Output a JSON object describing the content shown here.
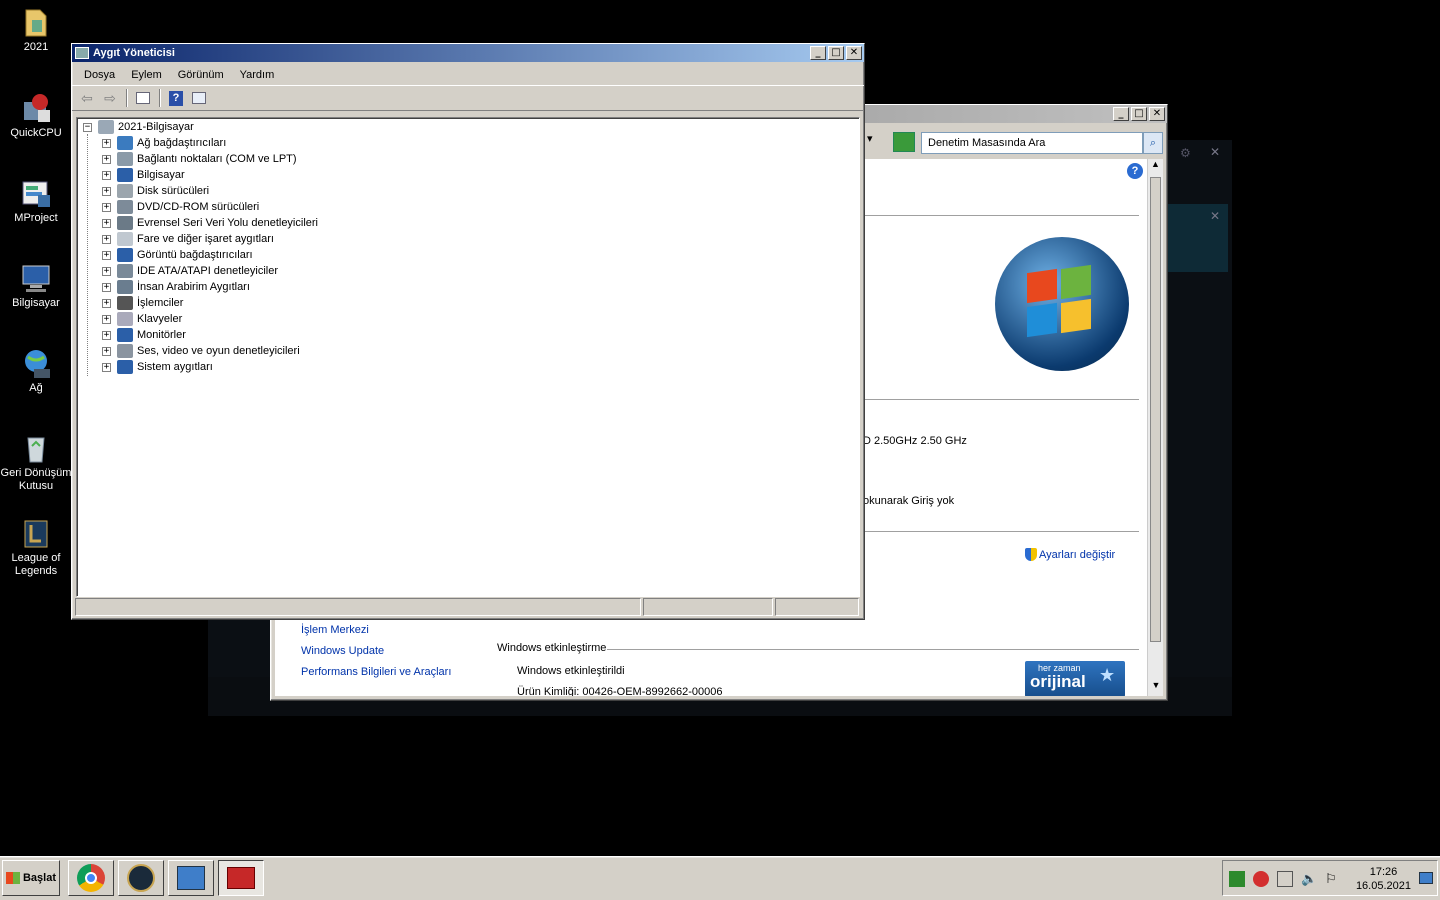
{
  "desktop": {
    "icons": [
      {
        "label": "2021",
        "icon": "folder-icon"
      },
      {
        "label": "QuickCPU",
        "icon": "quickcpu-icon"
      },
      {
        "label": "MProject",
        "icon": "mproject-icon"
      },
      {
        "label": "Bilgisayar",
        "icon": "computer-icon"
      },
      {
        "label": "Ağ",
        "icon": "network-icon"
      },
      {
        "label": "Geri Dönüşüm Kutusu",
        "icon": "recycle-bin-icon"
      },
      {
        "label": "League of Legends",
        "icon": "league-icon"
      }
    ]
  },
  "device_manager": {
    "title": "Aygıt Yöneticisi",
    "menu": [
      "Dosya",
      "Eylem",
      "Görünüm",
      "Yardım"
    ],
    "root": "2021-Bilgisayar",
    "categories": [
      "Ağ bağdaştırıcıları",
      "Bağlantı noktaları (COM ve LPT)",
      "Bilgisayar",
      "Disk sürücüleri",
      "DVD/CD-ROM sürücüleri",
      "Evrensel Seri Veri Yolu denetleyicileri",
      "Fare ve diğer işaret aygıtları",
      "Görüntü bağdaştırıcıları",
      "IDE ATA/ATAPI denetleyiciler",
      "İnsan Arabirim Aygıtları",
      "İşlemciler",
      "Klavyeler",
      "Monitörler",
      "Ses, video ve oyun denetleyicileri",
      "Sistem aygıtları"
    ]
  },
  "control_panel": {
    "search_placeholder": "Denetim Masasında Ara",
    "cpu_text": "D 2.50GHz   2.50 GHz",
    "pen_touch_text": "okunarak Giriş yok",
    "change_settings": "Ayarları değiştir",
    "sidebar_links": [
      "İşlem Merkezi",
      "Windows Update",
      "Performans Bilgileri ve Araçları"
    ],
    "activation_header": "Windows etkinleştirme",
    "activation_status": "Windows etkinleştirildi",
    "product_id": "Ürün Kimliği:  00426-OEM-8992662-00006",
    "genuine_badge": "her zaman",
    "genuine_word": "orijinal"
  },
  "taskbar": {
    "start_label": "Başlat",
    "time": "17:26",
    "date": "16.05.2021"
  }
}
